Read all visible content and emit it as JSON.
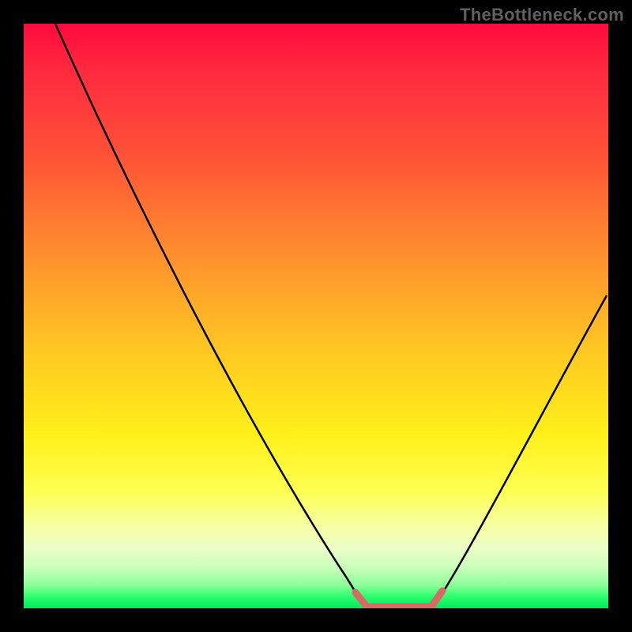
{
  "watermark": "TheBottleneck.com",
  "chart_data": {
    "type": "line",
    "title": "",
    "xlabel": "",
    "ylabel": "",
    "ylim": [
      0,
      100
    ],
    "xlim": [
      0,
      100
    ],
    "series": [
      {
        "name": "main-curve",
        "x": [
          0,
          10,
          20,
          30,
          40,
          50,
          56,
          58,
          62,
          66,
          70,
          72,
          76,
          82,
          88,
          94,
          100
        ],
        "y": [
          100,
          84,
          68,
          52,
          36,
          20,
          8,
          3,
          0,
          0,
          0,
          3,
          9,
          20,
          34,
          48,
          62
        ]
      }
    ],
    "flat_region": {
      "x_start": 56,
      "x_end": 72,
      "color": "#d86a66"
    },
    "gradient_stops": [
      {
        "pos": 0,
        "color": "#ff0a3e"
      },
      {
        "pos": 8,
        "color": "#ff2a3e"
      },
      {
        "pos": 22,
        "color": "#ff5037"
      },
      {
        "pos": 38,
        "color": "#ff8a2e"
      },
      {
        "pos": 55,
        "color": "#ffc522"
      },
      {
        "pos": 70,
        "color": "#fff018"
      },
      {
        "pos": 80,
        "color": "#fdff52"
      },
      {
        "pos": 86,
        "color": "#f6ffa6"
      },
      {
        "pos": 90,
        "color": "#e9ffc8"
      },
      {
        "pos": 93,
        "color": "#c9ffbb"
      },
      {
        "pos": 96,
        "color": "#8eff9a"
      },
      {
        "pos": 98,
        "color": "#2bff6e"
      },
      {
        "pos": 100,
        "color": "#00e95c"
      }
    ]
  }
}
